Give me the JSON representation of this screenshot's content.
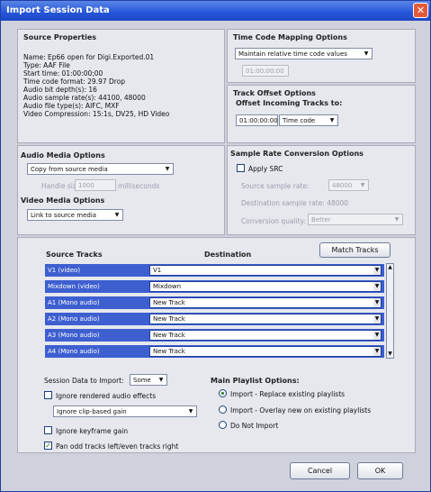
{
  "window": {
    "title": "Import Session Data",
    "close_icon": "close-icon"
  },
  "source_properties": {
    "title": "Source Properties",
    "lines": [
      "Name: Ep66 open for Digi.Exported.01",
      "Type: AAF File",
      "Start time: 01:00:00;00",
      "Time code format: 29.97 Drop",
      "Audio bit depth(s): 16",
      "Audio sample rate(s): 44100, 48000",
      "Audio file type(s): AIFC, MXF",
      "Video Compression: 15:1s, DV25, HD Video"
    ]
  },
  "tc_mapping": {
    "title": "Time Code Mapping Options",
    "select": "Maintain relative time code values",
    "timecode": "01:00:00:00"
  },
  "track_offset": {
    "title": "Track Offset Options",
    "subtitle": "Offset Incoming Tracks to:",
    "value": "01:00:00:00",
    "unit": "Time code"
  },
  "audio_media": {
    "title": "Audio Media Options",
    "select": "Copy from source media",
    "handle_label": "Handle size",
    "handle_value": "1000",
    "handle_unit": "milliseconds"
  },
  "video_media": {
    "title": "Video Media Options",
    "select": "Link to source media"
  },
  "src": {
    "title": "Sample Rate Conversion Options",
    "apply": "Apply SRC",
    "source_rate_label": "Source sample rate:",
    "source_rate_value": "48000",
    "dest_rate": "Destination sample rate: 48000",
    "quality_label": "Conversion quality:",
    "quality_value": "Better"
  },
  "tracks": {
    "source_header": "Source Tracks",
    "dest_header": "Destination",
    "match_button": "Match Tracks",
    "rows": [
      {
        "source": "V1 (video)",
        "dest": "V1"
      },
      {
        "source": "Mixdown (video)",
        "dest": "Mixdown"
      },
      {
        "source": "A1 (Mono audio)",
        "dest": "New Track"
      },
      {
        "source": "A2 (Mono audio)",
        "dest": "New Track"
      },
      {
        "source": "A3 (Mono audio)",
        "dest": "New Track"
      },
      {
        "source": "A4 (Mono audio)",
        "dest": "New Track"
      }
    ]
  },
  "session_import": {
    "label": "Session Data to Import:",
    "value": "Some"
  },
  "options": {
    "ignore_rendered": "Ignore rendered audio effects",
    "clip_gain_select": "Ignore clip-based gain",
    "ignore_keyframe": "Ignore keyframe gain",
    "pan_odd": "Pan odd tracks left/even tracks right"
  },
  "playlist": {
    "title": "Main Playlist Options:",
    "opt1": "Import - Replace existing playlists",
    "opt2": "Import - Overlay new on existing playlists",
    "opt3": "Do Not Import"
  },
  "footer": {
    "cancel": "Cancel",
    "ok": "OK"
  }
}
